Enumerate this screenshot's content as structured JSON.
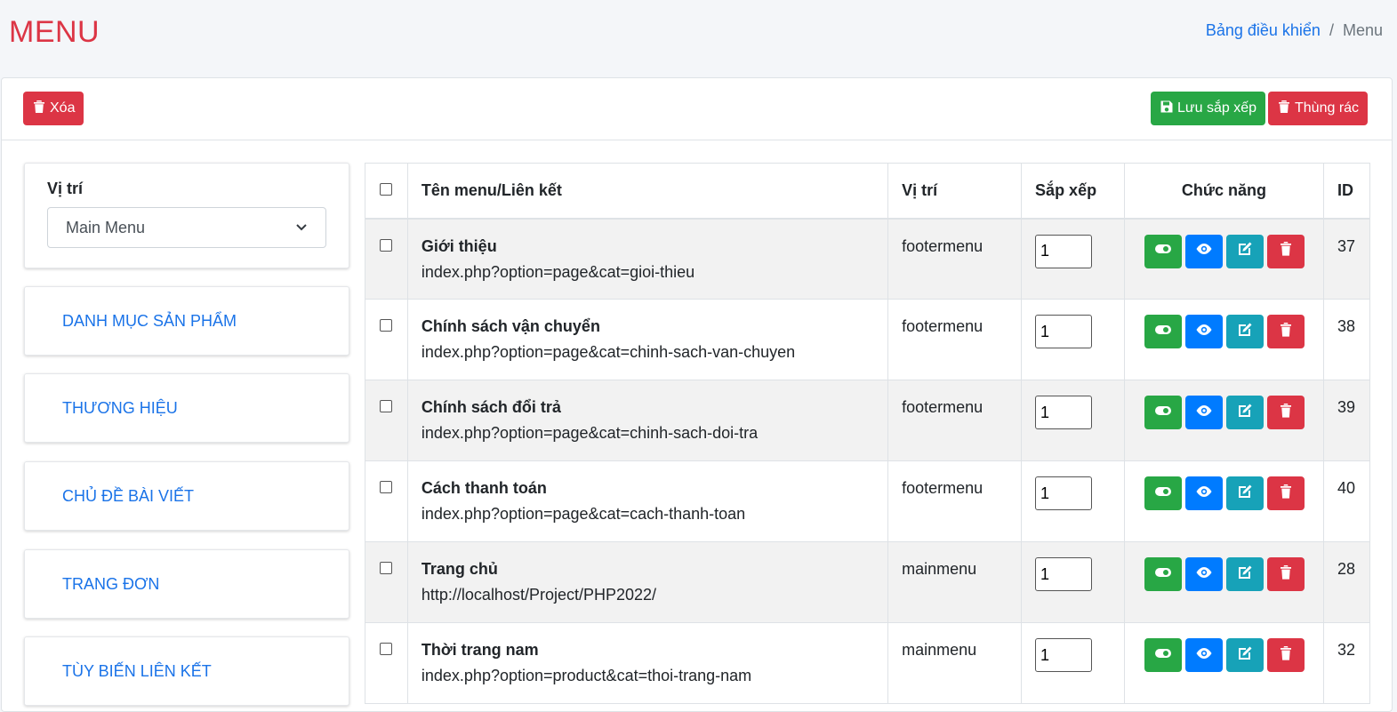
{
  "page": {
    "title": "MENU"
  },
  "breadcrumb": {
    "home": "Bảng điều khiển",
    "separator": "/",
    "current": "Menu"
  },
  "toolbar": {
    "delete_label": "Xóa",
    "save_order_label": "Lưu sắp xếp",
    "trash_label": "Thùng rác"
  },
  "sidebar": {
    "position_label": "Vị trí",
    "position_selected": "Main Menu",
    "links": [
      "DANH MỤC SẢN PHẨM",
      "THƯƠNG HIỆU",
      "CHỦ ĐỀ BÀI VIẾT",
      "TRANG ĐƠN",
      "TÙY BIẾN LIÊN KẾT"
    ]
  },
  "table": {
    "headers": {
      "name": "Tên menu/Liên kết",
      "position": "Vị trí",
      "sort": "Sắp xếp",
      "actions": "Chức năng",
      "id": "ID"
    },
    "rows": [
      {
        "name": "Giới thiệu",
        "link": "index.php?option=page&cat=gioi-thieu",
        "position": "footermenu",
        "sort": "1",
        "id": "37"
      },
      {
        "name": "Chính sách vận chuyển",
        "link": "index.php?option=page&cat=chinh-sach-van-chuyen",
        "position": "footermenu",
        "sort": "1",
        "id": "38"
      },
      {
        "name": "Chính sách đổi trả",
        "link": "index.php?option=page&cat=chinh-sach-doi-tra",
        "position": "footermenu",
        "sort": "1",
        "id": "39"
      },
      {
        "name": "Cách thanh toán",
        "link": "index.php?option=page&cat=cach-thanh-toan",
        "position": "footermenu",
        "sort": "1",
        "id": "40"
      },
      {
        "name": "Trang chủ",
        "link": "http://localhost/Project/PHP2022/",
        "position": "mainmenu",
        "sort": "1",
        "id": "28"
      },
      {
        "name": "Thời trang nam",
        "link": "index.php?option=product&cat=thoi-trang-nam",
        "position": "mainmenu",
        "sort": "1",
        "id": "32"
      }
    ]
  },
  "colors": {
    "danger": "#dc3545",
    "success": "#28a745",
    "primary": "#007bff",
    "info": "#17a2b8",
    "link": "#1a73e8"
  }
}
